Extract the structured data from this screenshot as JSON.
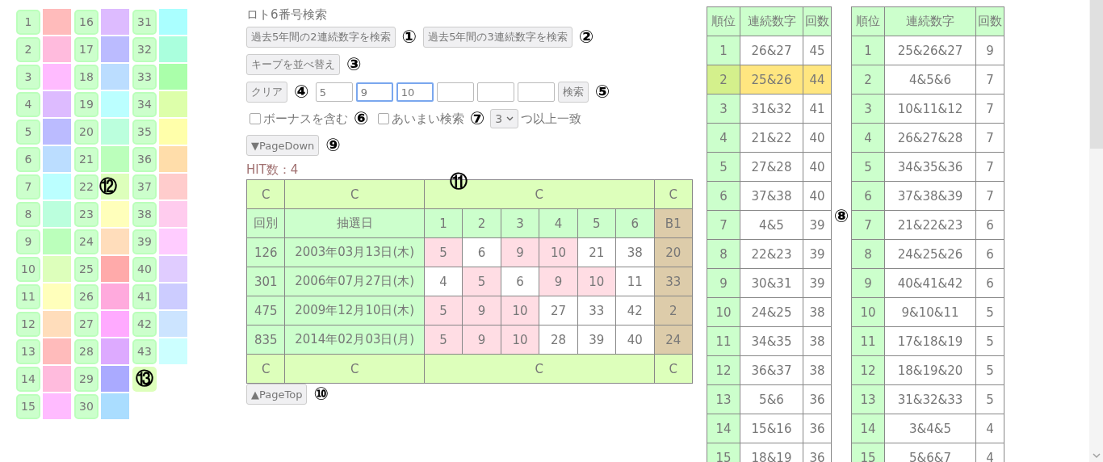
{
  "number_grid": [
    {
      "kind": "number",
      "number": "1",
      "color": "#ffbbbb"
    },
    {
      "kind": "number",
      "number": "2",
      "color": "#ffbbdd"
    },
    {
      "kind": "number",
      "number": "3",
      "color": "#ffbbff"
    },
    {
      "kind": "number",
      "number": "4",
      "color": "#ddbbff"
    },
    {
      "kind": "number",
      "number": "5",
      "color": "#bbbbff"
    },
    {
      "kind": "number",
      "number": "6",
      "color": "#bbddff"
    },
    {
      "kind": "number",
      "number": "7",
      "color": "#bbffff"
    },
    {
      "kind": "number",
      "number": "8",
      "color": "#bbffdd"
    },
    {
      "kind": "number",
      "number": "9",
      "color": "#bbffbb"
    },
    {
      "kind": "number",
      "number": "10",
      "color": "#ddffbb"
    },
    {
      "kind": "number",
      "number": "11",
      "color": "#ffffbb"
    },
    {
      "kind": "number",
      "number": "12",
      "color": "#ffddbb"
    },
    {
      "kind": "number",
      "number": "13",
      "color": "#ffbbbb"
    },
    {
      "kind": "number",
      "number": "14",
      "color": "#ffbbdd"
    },
    {
      "kind": "number",
      "number": "15",
      "color": "#ffbbff"
    },
    {
      "kind": "number",
      "number": "16",
      "color": "#ddbbff"
    },
    {
      "kind": "number",
      "number": "17",
      "color": "#bbbbff"
    },
    {
      "kind": "number",
      "number": "18",
      "color": "#bbddff"
    },
    {
      "kind": "number",
      "number": "19",
      "color": "#bbffff"
    },
    {
      "kind": "number",
      "number": "20",
      "color": "#bbffdd"
    },
    {
      "kind": "number",
      "number": "21",
      "color": "#bbffbb"
    },
    {
      "kind": "number",
      "number": "22",
      "color": "#ddffbb",
      "marker": "⑫"
    },
    {
      "kind": "number",
      "number": "23",
      "color": "#ffffbb"
    },
    {
      "kind": "number",
      "number": "24",
      "color": "#ffddbb"
    },
    {
      "kind": "number",
      "number": "25",
      "color": "#ffaaaa"
    },
    {
      "kind": "number",
      "number": "26",
      "color": "#ffaadd"
    },
    {
      "kind": "number",
      "number": "27",
      "color": "#ffaaff"
    },
    {
      "kind": "number",
      "number": "28",
      "color": "#ddaaff"
    },
    {
      "kind": "number",
      "number": "29",
      "color": "#aaaaff"
    },
    {
      "kind": "number",
      "number": "30",
      "color": "#aaddff"
    },
    {
      "kind": "number",
      "number": "31",
      "color": "#aaffff"
    },
    {
      "kind": "number",
      "number": "32",
      "color": "#aaffdd"
    },
    {
      "kind": "number",
      "number": "33",
      "color": "#aaffaa"
    },
    {
      "kind": "number",
      "number": "34",
      "color": "#ddffaa"
    },
    {
      "kind": "number",
      "number": "35",
      "color": "#ffffaa"
    },
    {
      "kind": "number",
      "number": "36",
      "color": "#ffddaa"
    },
    {
      "kind": "number",
      "number": "37",
      "color": "#ffcccc"
    },
    {
      "kind": "number",
      "number": "38",
      "color": "#ffccee"
    },
    {
      "kind": "number",
      "number": "39",
      "color": "#ffccff"
    },
    {
      "kind": "number",
      "number": "40",
      "color": "#e0ccff"
    },
    {
      "kind": "number",
      "number": "41",
      "color": "#ccccff"
    },
    {
      "kind": "number",
      "number": "42",
      "color": "#cce4ff"
    },
    {
      "kind": "number",
      "number": "43",
      "color": "#ccffff"
    },
    {
      "kind": "blank",
      "marker": "⑬"
    }
  ],
  "title": "ロト6番号検索",
  "top_buttons": [
    {
      "label": "過去5年間の2連続数字を検索",
      "marker": "①"
    },
    {
      "label": "過去5年間の3連続数字を検索",
      "marker": "②"
    }
  ],
  "sort_button": {
    "label": "キープを並べ替え",
    "marker": "③"
  },
  "search_row": {
    "clear_button": {
      "label": "クリア",
      "marker": "④"
    },
    "fields": [
      {
        "value": "5",
        "focused": false
      },
      {
        "value": "9",
        "focused": true
      },
      {
        "value": "10",
        "focused": true
      },
      {
        "focused": false
      },
      {
        "focused": false
      },
      {
        "focused": false
      }
    ],
    "search_button": {
      "label": "検索",
      "marker": "⑤"
    }
  },
  "options": {
    "bonus": {
      "label": "ボーナスを含む",
      "checked": false,
      "marker": "⑥"
    },
    "fuzzy": {
      "label": "あいまい検索",
      "checked": false,
      "marker": "⑦"
    },
    "match_select": {
      "value": "3"
    },
    "match_suffix": "つ以上一致"
  },
  "page_down": {
    "label": "▼PageDown",
    "marker": "⑨"
  },
  "hit_count": "HIT数：4",
  "results": {
    "marker": "⑪",
    "top_row": [
      "C",
      "C",
      "C",
      "C"
    ],
    "columns": [
      "回別",
      "抽選日",
      "1",
      "2",
      "3",
      "4",
      "5",
      "6",
      "B1"
    ],
    "rows": [
      {
        "round": "126",
        "date": "2003年03月13日(木)",
        "numbers": [
          {
            "value": "5",
            "hit": true
          },
          {
            "value": "6",
            "hit": false
          },
          {
            "value": "9",
            "hit": true
          },
          {
            "value": "10",
            "hit": true
          },
          {
            "value": "21",
            "hit": false
          },
          {
            "value": "38",
            "hit": false
          }
        ],
        "bonus": "20"
      },
      {
        "round": "301",
        "date": "2006年07月27日(木)",
        "numbers": [
          {
            "value": "4",
            "hit": false
          },
          {
            "value": "5",
            "hit": true
          },
          {
            "value": "6",
            "hit": false
          },
          {
            "value": "9",
            "hit": true
          },
          {
            "value": "10",
            "hit": true
          },
          {
            "value": "11",
            "hit": false
          }
        ],
        "bonus": "33"
      },
      {
        "round": "475",
        "date": "2009年12月10日(木)",
        "numbers": [
          {
            "value": "5",
            "hit": true
          },
          {
            "value": "9",
            "hit": true
          },
          {
            "value": "10",
            "hit": true
          },
          {
            "value": "27",
            "hit": false
          },
          {
            "value": "33",
            "hit": false
          },
          {
            "value": "42",
            "hit": false
          }
        ],
        "bonus": "2"
      },
      {
        "round": "835",
        "date": "2014年02月03日(月)",
        "numbers": [
          {
            "value": "5",
            "hit": true
          },
          {
            "value": "9",
            "hit": true
          },
          {
            "value": "10",
            "hit": true
          },
          {
            "value": "28",
            "hit": false
          },
          {
            "value": "39",
            "hit": false
          },
          {
            "value": "40",
            "hit": false
          }
        ],
        "bonus": "24"
      }
    ],
    "bottom_row": [
      "C",
      "C",
      "C",
      "C"
    ]
  },
  "page_top": {
    "label": "▲PageTop",
    "marker": "⑩"
  },
  "rank_marker": "⑧",
  "pair_ranking": {
    "columns": [
      "順位",
      "連続数字",
      "回数"
    ],
    "rows": [
      {
        "rank": "1",
        "numbers": "26&27",
        "count": "45",
        "selected": false
      },
      {
        "rank": "2",
        "numbers": "25&26",
        "count": "44",
        "selected": true
      },
      {
        "rank": "3",
        "numbers": "31&32",
        "count": "41",
        "selected": false
      },
      {
        "rank": "4",
        "numbers": "21&22",
        "count": "40",
        "selected": false
      },
      {
        "rank": "5",
        "numbers": "27&28",
        "count": "40",
        "selected": false
      },
      {
        "rank": "6",
        "numbers": "37&38",
        "count": "40",
        "selected": false
      },
      {
        "rank": "7",
        "numbers": "4&5",
        "count": "39",
        "selected": false
      },
      {
        "rank": "8",
        "numbers": "22&23",
        "count": "39",
        "selected": false
      },
      {
        "rank": "9",
        "numbers": "30&31",
        "count": "39",
        "selected": false
      },
      {
        "rank": "10",
        "numbers": "24&25",
        "count": "38",
        "selected": false
      },
      {
        "rank": "11",
        "numbers": "34&35",
        "count": "38",
        "selected": false
      },
      {
        "rank": "12",
        "numbers": "36&37",
        "count": "38",
        "selected": false
      },
      {
        "rank": "13",
        "numbers": "5&6",
        "count": "36",
        "selected": false
      },
      {
        "rank": "14",
        "numbers": "15&16",
        "count": "36",
        "selected": false
      },
      {
        "rank": "15",
        "numbers": "18&19",
        "count": "36",
        "selected": false
      }
    ]
  },
  "triple_ranking": {
    "columns": [
      "順位",
      "連続数字",
      "回数"
    ],
    "rows": [
      {
        "rank": "1",
        "numbers": "25&26&27",
        "count": "9",
        "selected": false
      },
      {
        "rank": "2",
        "numbers": "4&5&6",
        "count": "7",
        "selected": false
      },
      {
        "rank": "3",
        "numbers": "10&11&12",
        "count": "7",
        "selected": false
      },
      {
        "rank": "4",
        "numbers": "26&27&28",
        "count": "7",
        "selected": false
      },
      {
        "rank": "5",
        "numbers": "34&35&36",
        "count": "7",
        "selected": false
      },
      {
        "rank": "6",
        "numbers": "37&38&39",
        "count": "7",
        "selected": false
      },
      {
        "rank": "7",
        "numbers": "21&22&23",
        "count": "6",
        "selected": false
      },
      {
        "rank": "8",
        "numbers": "24&25&26",
        "count": "6",
        "selected": false
      },
      {
        "rank": "9",
        "numbers": "40&41&42",
        "count": "6",
        "selected": false
      },
      {
        "rank": "10",
        "numbers": "9&10&11",
        "count": "5",
        "selected": false
      },
      {
        "rank": "11",
        "numbers": "17&18&19",
        "count": "5",
        "selected": false
      },
      {
        "rank": "12",
        "numbers": "18&19&20",
        "count": "5",
        "selected": false
      },
      {
        "rank": "13",
        "numbers": "31&32&33",
        "count": "5",
        "selected": false
      },
      {
        "rank": "14",
        "numbers": "3&4&5",
        "count": "4",
        "selected": false
      },
      {
        "rank": "15",
        "numbers": "5&6&7",
        "count": "4",
        "selected": false
      }
    ]
  }
}
